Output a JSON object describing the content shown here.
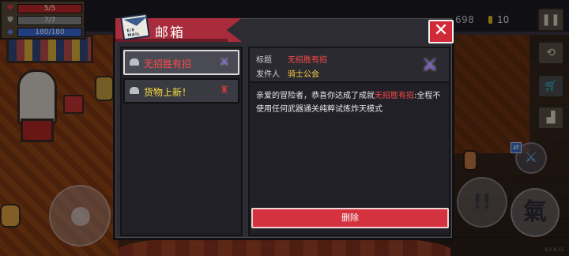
{
  "hud": {
    "hp": "5/5",
    "hp_fraction": 1.0,
    "armor": "7/7",
    "armor_fraction": 1.0,
    "energy": "180/180",
    "energy_fraction": 1.0,
    "coins": "698",
    "gems": "10"
  },
  "controls": {
    "skill_label": "氣",
    "attack_label": "!!",
    "version": "6.0.0.15"
  },
  "mailbox": {
    "title": "邮箱",
    "logo_text": "E/E MAIL",
    "mails": [
      {
        "subject": "无招胜有招",
        "thumb_icon": "sword-icon",
        "selected": true
      },
      {
        "subject": "货物上新！",
        "thumb_icon": "merchant-icon",
        "selected": false
      }
    ],
    "detail": {
      "title_label": "标题",
      "title_value": "无招胜有招",
      "sender_label": "发件人",
      "sender_value": "骑士公会",
      "body_pre": "亲爱的冒险者，恭喜你达成了成就",
      "body_highlight": "无招胜有招",
      "body_post": ":全程不使用任何武器通关纯粹试炼炸天模式"
    },
    "delete_label": "删除"
  },
  "colors": {
    "accent_red": "#d4323e",
    "ribbon_red": "#a82c3c",
    "highlight_red": "#ff4a4a",
    "highlight_yellow": "#ffce40"
  }
}
